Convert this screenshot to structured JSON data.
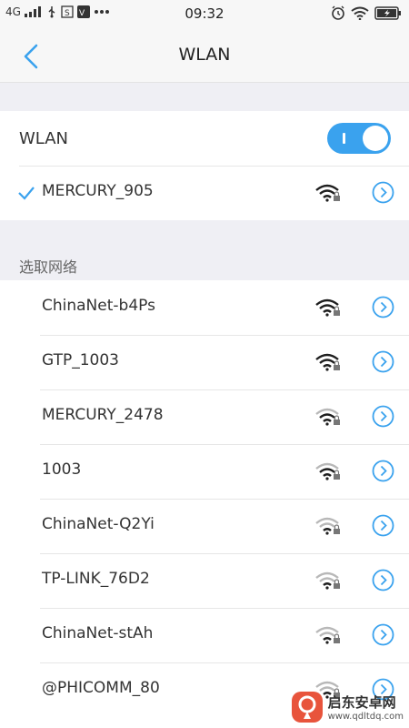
{
  "status_bar": {
    "network": "4G",
    "time": "09:32"
  },
  "header": {
    "title": "WLAN"
  },
  "wlan": {
    "label": "WLAN",
    "enabled": true
  },
  "connected": {
    "ssid": "MERCURY_905",
    "signal": 3
  },
  "section_label": "选取网络",
  "networks": [
    {
      "ssid": "ChinaNet-b4Ps",
      "signal": 4
    },
    {
      "ssid": "GTP_1003",
      "signal": 4
    },
    {
      "ssid": "MERCURY_2478",
      "signal": 3
    },
    {
      "ssid": "1003",
      "signal": 3
    },
    {
      "ssid": "ChinaNet-Q2Yi",
      "signal": 2
    },
    {
      "ssid": "TP-LINK_76D2",
      "signal": 2
    },
    {
      "ssid": "ChinaNet-stAh",
      "signal": 2
    },
    {
      "ssid": "@PHICOMM_80",
      "signal": 2
    }
  ],
  "watermark": {
    "name": "启东安卓网",
    "url": "www.qdltdq.com"
  },
  "colors": {
    "accent": "#3aa2ee",
    "background": "#efeff4"
  }
}
